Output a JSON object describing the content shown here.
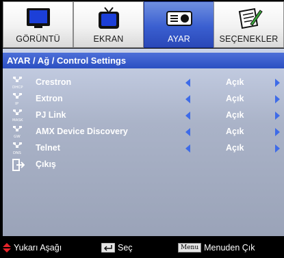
{
  "tabs": [
    {
      "label": "GÖRÜNTÜ",
      "icon": "monitor-icon",
      "active": false
    },
    {
      "label": "EKRAN",
      "icon": "tv-icon",
      "active": false
    },
    {
      "label": "AYAR",
      "icon": "projector-icon",
      "active": true
    },
    {
      "label": "SEÇENEKLER",
      "icon": "notepad-pencil-icon",
      "active": false
    }
  ],
  "breadcrumb": "AYAR / Ağ / Control Settings",
  "rows": [
    {
      "label": "Crestron",
      "value": "Açık",
      "icon": "network-dhcp-icon"
    },
    {
      "label": "Extron",
      "value": "Açık",
      "icon": "network-ip-icon"
    },
    {
      "label": "PJ Link",
      "value": "Açık",
      "icon": "network-mask-icon"
    },
    {
      "label": "AMX Device Discovery",
      "value": "Açık",
      "icon": "network-gw-icon"
    },
    {
      "label": "Telnet",
      "value": "Açık",
      "icon": "network-dns-icon"
    }
  ],
  "exit": {
    "label": "Çıkış",
    "icon": "exit-icon"
  },
  "icon_captions": [
    "DHCP",
    "IP",
    "MASK",
    "GW",
    "DNS"
  ],
  "footer": {
    "nav": "Yukarı Aşağı",
    "select": "Seç",
    "menu_key": "Menu",
    "exit": "Menuden Çık"
  },
  "colors": {
    "accent": "#2b4fc2",
    "arrow": "#3e6be8",
    "panel": "#aab3c8",
    "nav_arrow": "#e8242a"
  }
}
